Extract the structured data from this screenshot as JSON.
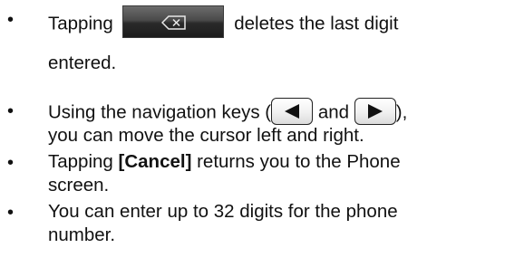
{
  "bullets": [
    {
      "marker": "•",
      "line1_before": "Tapping",
      "icon": "backspace-icon",
      "line1_after": "deletes the last digit",
      "line2": "entered."
    },
    {
      "marker": "•",
      "line1_before": "Using the navigation keys (",
      "left_icon": "left-arrow-icon",
      "line1_middle": " and ",
      "right_icon": "right-arrow-icon",
      "line1_after": "),",
      "line2": "you can move the cursor left and right."
    },
    {
      "marker": "•",
      "line1_before": "Tapping ",
      "line1_bold": "[Cancel]",
      "line1_after": " returns you to the Phone",
      "line2": "screen."
    },
    {
      "marker": "•",
      "line1": "You can enter up to 32 digits for the phone",
      "line2": "number."
    }
  ]
}
